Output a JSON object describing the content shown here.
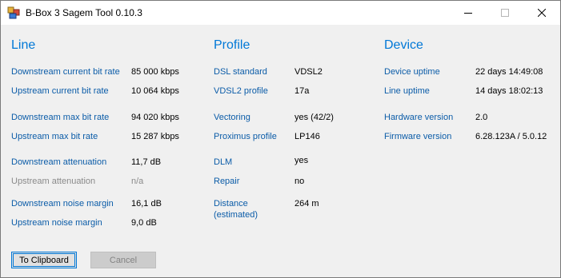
{
  "window": {
    "title": "B-Box 3 Sagem Tool 0.10.3"
  },
  "sections": {
    "line": {
      "heading": "Line",
      "rows": [
        {
          "label": "Downstream current bit rate",
          "value": "85 000 kbps"
        },
        {
          "label": "Upstream current bit rate",
          "value": "10 064 kbps"
        },
        {
          "label": "Downstream max bit rate",
          "value": "94 020 kbps"
        },
        {
          "label": "Upstream max bit rate",
          "value": "15 287 kbps"
        },
        {
          "label": "Downstream attenuation",
          "value": "11,7 dB"
        },
        {
          "label": "Upstream attenuation",
          "value": "n/a",
          "disabled": true
        },
        {
          "label": "Downstream noise margin",
          "value": "16,1 dB"
        },
        {
          "label": "Upstream noise margin",
          "value": "9,0 dB"
        }
      ]
    },
    "profile": {
      "heading": "Profile",
      "rows": [
        {
          "label": "DSL standard",
          "value": "VDSL2"
        },
        {
          "label": "VDSL2 profile",
          "value": "17a"
        },
        {
          "label": "Vectoring",
          "value": "yes (42/2)"
        },
        {
          "label": "Proximus profile",
          "value": "LP146"
        },
        {
          "label": "DLM",
          "value": "yes"
        },
        {
          "label": "Repair",
          "value": "no"
        },
        {
          "label_line1": "Distance",
          "label_line2": "(estimated)",
          "value": "264 m"
        }
      ]
    },
    "device": {
      "heading": "Device",
      "rows": [
        {
          "label": "Device uptime",
          "value": "22 days 14:49:08"
        },
        {
          "label": "Line uptime",
          "value": "14 days 18:02:13"
        },
        {
          "label": "Hardware version",
          "value": "2.0"
        },
        {
          "label": "Firmware version",
          "value": "6.28.123A / 5.0.12"
        }
      ]
    }
  },
  "buttons": {
    "clipboard": "To Clipboard",
    "cancel": "Cancel"
  },
  "colors": {
    "accent": "#0078d7",
    "label": "#0b5ca8",
    "disabled": "#8a8a8a"
  },
  "icons": {
    "app": "app-icon",
    "minimize": "minimize-icon",
    "maximize": "maximize-icon",
    "close": "close-icon"
  }
}
